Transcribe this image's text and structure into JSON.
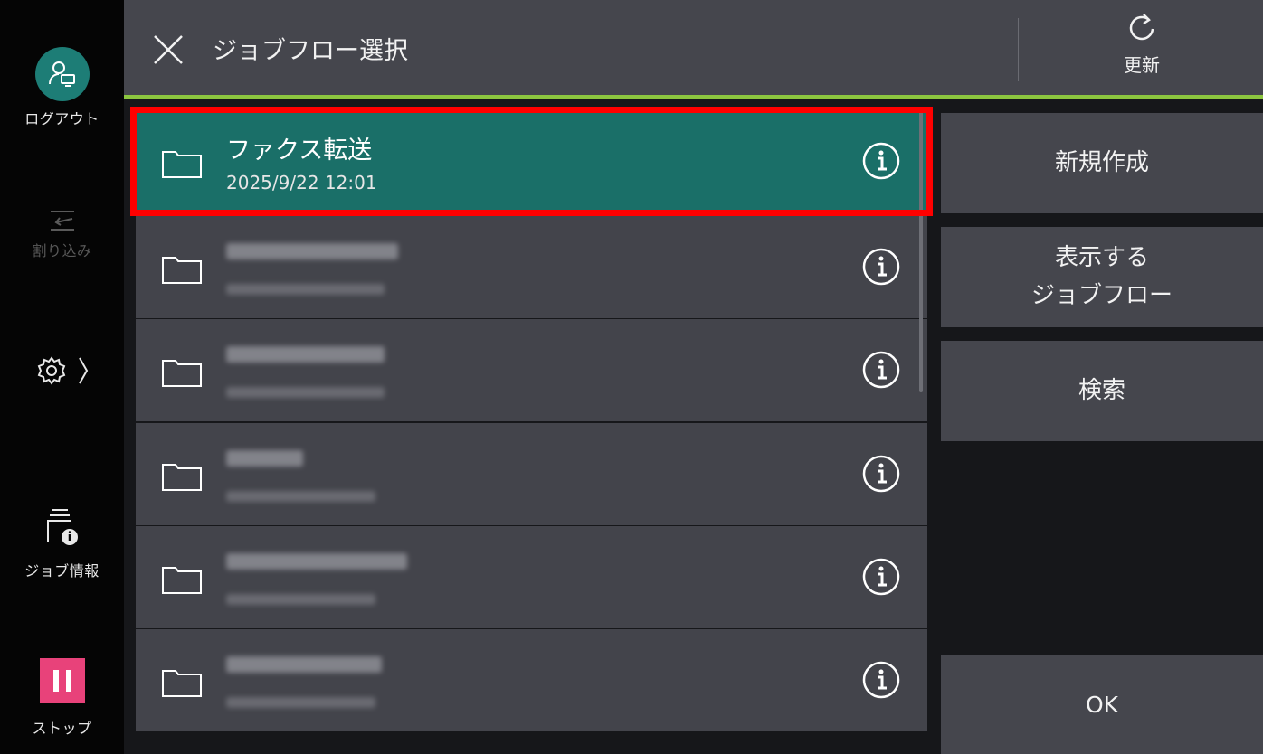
{
  "header": {
    "title": "ジョブフロー選択",
    "refresh_label": "更新"
  },
  "rail": {
    "logout_label": "ログアウト",
    "interrupt_label": "割り込み",
    "job_info_label": "ジョブ情報",
    "stop_label": "ストップ"
  },
  "list": {
    "items": [
      {
        "name": "ファクス転送",
        "date": "2025/9/22  12:01",
        "selected": true
      },
      {
        "name": "",
        "date": "",
        "selected": false
      },
      {
        "name": "",
        "date": "",
        "selected": false
      },
      {
        "name": "",
        "date": "",
        "selected": false
      },
      {
        "name": "",
        "date": "",
        "selected": false
      },
      {
        "name": "",
        "date": "",
        "selected": false
      }
    ]
  },
  "actions": {
    "new_label": "新規作成",
    "show_label_line1": "表示する",
    "show_label_line2": "ジョブフロー",
    "search_label": "検索",
    "ok_label": "OK"
  },
  "colors": {
    "selected_row": "#1a6f68",
    "accent_bar": "#8cc63f",
    "highlight_box": "#ff0000",
    "stop_button": "#e8427a",
    "avatar": "#1d7d76"
  }
}
